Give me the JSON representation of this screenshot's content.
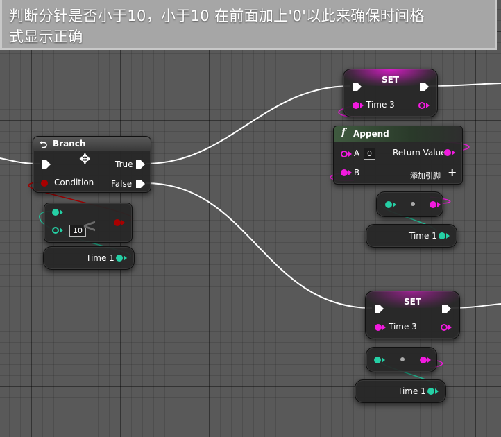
{
  "banner": {
    "line1": "判断分针是否小于10，小于10 在前面加上'0'以此来确保时间格",
    "line2": "式显示正确"
  },
  "branch": {
    "title": "Branch",
    "true_label": "True",
    "condition_label": "Condition",
    "false_label": "False"
  },
  "less_than": {
    "operator": "<",
    "b_value": "10"
  },
  "time1_getter_left": {
    "label": "Time 1"
  },
  "set_top": {
    "title": "SET",
    "pin_label": "Time 3"
  },
  "append": {
    "title": "Append",
    "a_label": "A",
    "a_value": "0",
    "return_label": "Return Value",
    "b_label": "B",
    "add_pin_label": "添加引脚"
  },
  "time1_getter_top": {
    "label": "Time 1"
  },
  "set_bottom": {
    "title": "SET",
    "pin_label": "Time 3"
  },
  "time1_getter_bottom": {
    "label": "Time 1"
  },
  "colors": {
    "string_pin": "#f21adf",
    "int_pin": "#25d0a5",
    "bool_pin": "#a80000",
    "exec_wire": "#ffffff",
    "banner_bg": "#a6a6a6",
    "grid_bg": "#595959"
  },
  "icons": {
    "branch": "branch-icon",
    "function": "function-icon",
    "cursor": "move-cursor-icon",
    "add": "plus-icon"
  }
}
